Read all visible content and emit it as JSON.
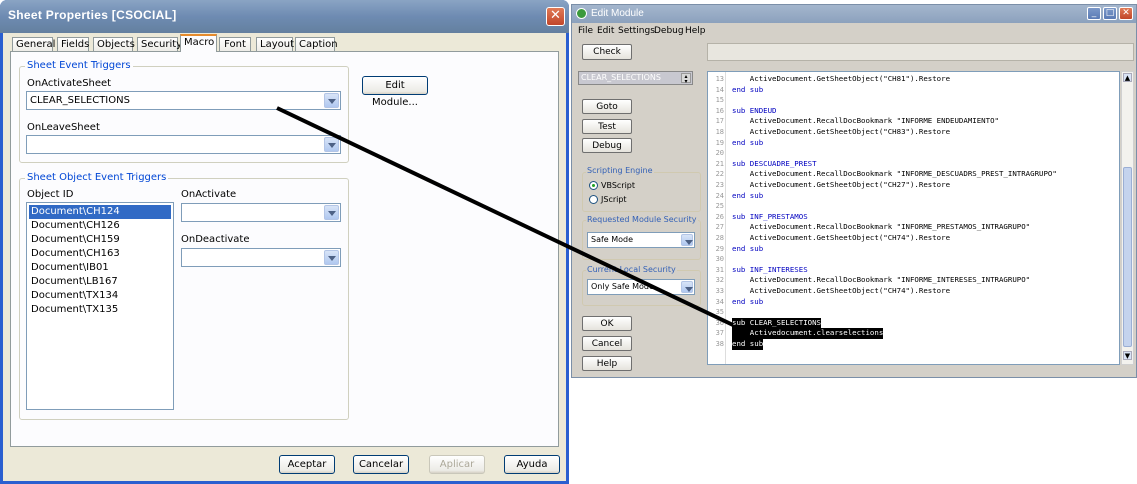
{
  "sheet_dialog": {
    "title": "Sheet Properties [CSOCIAL]",
    "tabs": [
      "General",
      "Fields",
      "Objects",
      "Security",
      "Macro",
      "Font",
      "Layout",
      "Caption"
    ],
    "sheet_event_triggers": {
      "group_label": "Sheet Event Triggers",
      "on_activate_label": "OnActivateSheet",
      "on_activate_value": "CLEAR_SELECTIONS",
      "on_leave_label": "OnLeaveSheet",
      "on_leave_value": "",
      "edit_module_label": "Edit Module..."
    },
    "object_event_triggers": {
      "group_label": "Sheet Object Event Triggers",
      "object_id_label": "Object ID",
      "objects": [
        "Document\\CH124",
        "Document\\CH126",
        "Document\\CH159",
        "Document\\CH163",
        "Document\\IB01",
        "Document\\LB167",
        "Document\\TX134",
        "Document\\TX135"
      ],
      "on_activate_label": "OnActivate",
      "on_activate_value": "",
      "on_deactivate_label": "OnDeactivate",
      "on_deactivate_value": ""
    },
    "buttons": {
      "ok": "Aceptar",
      "cancel": "Cancelar",
      "apply": "Aplicar",
      "help": "Ayuda"
    },
    "close_icon": "close-icon"
  },
  "edit_module": {
    "title": "Edit Module",
    "menu": [
      "File",
      "Edit",
      "Settings",
      "Debug",
      "Help"
    ],
    "check_label": "Check",
    "module_dropdown_value": "CLEAR_SELECTIONS",
    "side_buttons": {
      "goto": "Goto",
      "test": "Test",
      "debug": "Debug"
    },
    "scripting_engine": {
      "label": "Scripting Engine",
      "options": [
        "VBScript",
        "JScript"
      ],
      "selected": "VBScript"
    },
    "requested_security": {
      "label": "Requested Module Security",
      "value": "Safe Mode"
    },
    "current_security": {
      "label": "Current Local Security",
      "value": "Only Safe Mode"
    },
    "bottom_buttons": {
      "ok": "OK",
      "cancel": "Cancel",
      "help": "Help"
    },
    "code_lines": [
      {
        "n": "13",
        "text": "    ActiveDocument.GetSheetObject(\"CH81\").Restore"
      },
      {
        "n": "14",
        "text": "end sub"
      },
      {
        "n": "15",
        "text": ""
      },
      {
        "n": "16",
        "text": "sub ENDEUD"
      },
      {
        "n": "17",
        "text": "    ActiveDocument.RecallDocBookmark \"INFORME ENDEUDAMIENTO\""
      },
      {
        "n": "18",
        "text": "    ActiveDocument.GetSheetObject(\"CH83\").Restore"
      },
      {
        "n": "19",
        "text": "end sub"
      },
      {
        "n": "20",
        "text": ""
      },
      {
        "n": "21",
        "text": "sub DESCUADRE_PREST"
      },
      {
        "n": "22",
        "text": "    ActiveDocument.RecallDocBookmark \"INFORME_DESCUADRS_PREST_INTRAGRUPO\""
      },
      {
        "n": "23",
        "text": "    ActiveDocument.GetSheetObject(\"CH27\").Restore"
      },
      {
        "n": "24",
        "text": "end sub"
      },
      {
        "n": "25",
        "text": ""
      },
      {
        "n": "26",
        "text": "sub INF_PRESTAMOS"
      },
      {
        "n": "27",
        "text": "    ActiveDocument.RecallDocBookmark \"INFORME_PRESTAMOS_INTRAGRUPO\""
      },
      {
        "n": "28",
        "text": "    ActiveDocument.GetSheetObject(\"CH74\").Restore"
      },
      {
        "n": "29",
        "text": "end sub"
      },
      {
        "n": "30",
        "text": ""
      },
      {
        "n": "31",
        "text": "sub INF_INTERESES"
      },
      {
        "n": "32",
        "text": "    ActiveDocument.RecallDocBookmark \"INFORME_INTERESES_INTRAGRUPO\""
      },
      {
        "n": "33",
        "text": "    ActiveDocument.GetSheetObject(\"CH74\").Restore"
      },
      {
        "n": "34",
        "text": "end sub"
      },
      {
        "n": "35",
        "text": ""
      },
      {
        "n": "36",
        "text": "sub CLEAR_SELECTIONS"
      },
      {
        "n": "37",
        "text": "    Activedocument.clearselections"
      },
      {
        "n": "38",
        "text": "end sub"
      }
    ]
  },
  "colors": {
    "xp_blue": "#2a5fd0",
    "selection": "#316ac5",
    "group_label": "#0046d5"
  }
}
